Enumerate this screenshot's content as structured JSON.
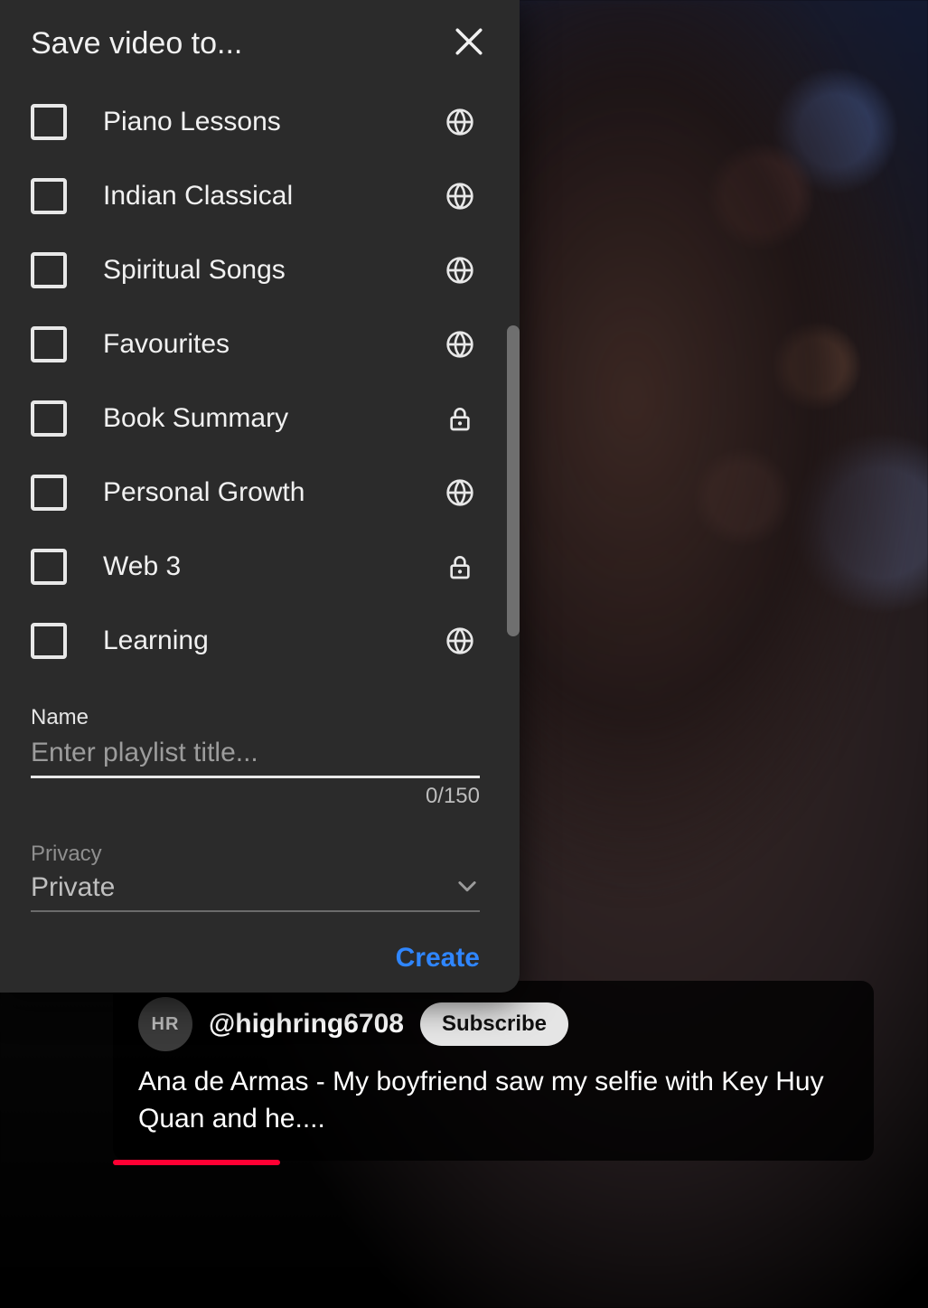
{
  "dialog": {
    "title": "Save video to...",
    "playlists": [
      {
        "label": "Piano Lessons",
        "visibility": "public"
      },
      {
        "label": "Indian Classical",
        "visibility": "public"
      },
      {
        "label": "Spiritual Songs",
        "visibility": "public"
      },
      {
        "label": "Favourites",
        "visibility": "public"
      },
      {
        "label": "Book Summary",
        "visibility": "private"
      },
      {
        "label": "Personal Growth",
        "visibility": "public"
      },
      {
        "label": "Web 3",
        "visibility": "private"
      },
      {
        "label": "Learning",
        "visibility": "public"
      }
    ],
    "name_field": {
      "label": "Name",
      "placeholder": "Enter playlist title...",
      "value": "",
      "counter": "0/150",
      "max": 150
    },
    "privacy_field": {
      "label": "Privacy",
      "value": "Private"
    },
    "create_label": "Create"
  },
  "video": {
    "channel_avatar_text": "HR",
    "channel_handle": "@highring6708",
    "subscribe_label": "Subscribe",
    "title": "Ana de Armas - My boyfriend saw my selfie with Key Huy Quan and he...."
  },
  "icons": {
    "close": "close-icon",
    "globe": "globe-icon",
    "lock": "lock-icon",
    "chevron_down": "chevron-down-icon"
  },
  "colors": {
    "dialog_bg": "#2b2b2b",
    "accent_link": "#2f86ff",
    "progress": "#ff0033"
  }
}
